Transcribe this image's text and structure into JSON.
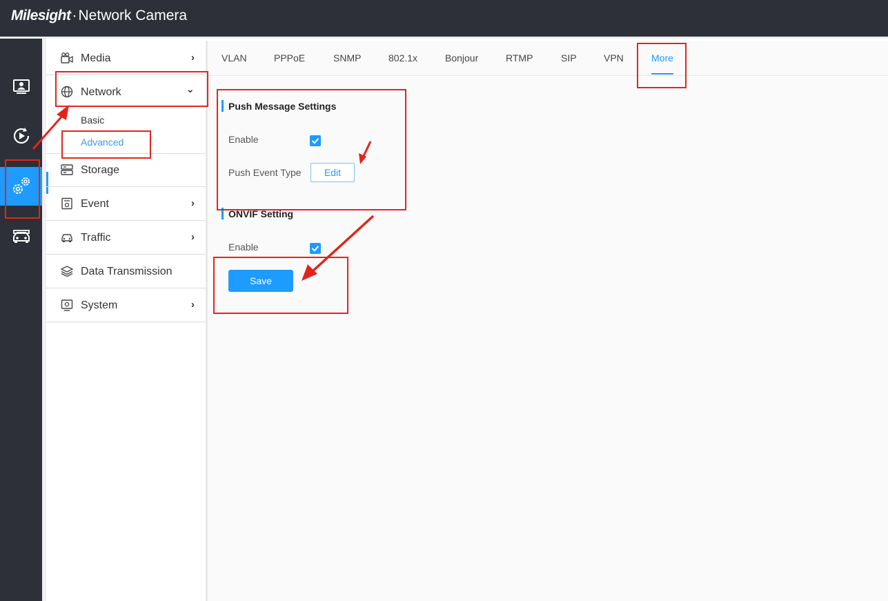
{
  "header": {
    "brand_logo": "Milesight",
    "brand_sep": "·",
    "brand_title": "Network Camera"
  },
  "rail": {
    "items": [
      {
        "icon": "live-view-icon"
      },
      {
        "icon": "playback-icon"
      },
      {
        "icon": "settings-icon",
        "active": true
      },
      {
        "icon": "vehicle-icon"
      }
    ]
  },
  "menu": {
    "items": [
      {
        "label": "Media",
        "icon": "media-icon",
        "chevron": "›"
      },
      {
        "label": "Network",
        "icon": "globe-icon",
        "chevron": "⌄",
        "expanded": true
      },
      {
        "label": "Storage",
        "icon": "storage-icon"
      },
      {
        "label": "Event",
        "icon": "event-icon",
        "chevron": "›"
      },
      {
        "label": "Traffic",
        "icon": "car-icon",
        "chevron": "›"
      },
      {
        "label": "Data Transmission",
        "icon": "layers-icon"
      },
      {
        "label": "System",
        "icon": "system-icon",
        "chevron": "›"
      }
    ],
    "network_sub": [
      "Basic",
      "Advanced"
    ],
    "active_sub": "Advanced"
  },
  "tabs": [
    "VLAN",
    "PPPoE",
    "SNMP",
    "802.1x",
    "Bonjour",
    "RTMP",
    "SIP",
    "VPN",
    "More"
  ],
  "active_tab": "More",
  "push": {
    "title": "Push Message Settings",
    "enable_label": "Enable",
    "enabled": true,
    "event_type_label": "Push Event Type",
    "edit_label": "Edit"
  },
  "onvif": {
    "title": "ONVIF Setting",
    "enable_label": "Enable",
    "enabled": true
  },
  "save_label": "Save",
  "colors": {
    "accent": "#1e9bff",
    "header_bg": "#2d3038",
    "annotation": "#e3241b"
  }
}
